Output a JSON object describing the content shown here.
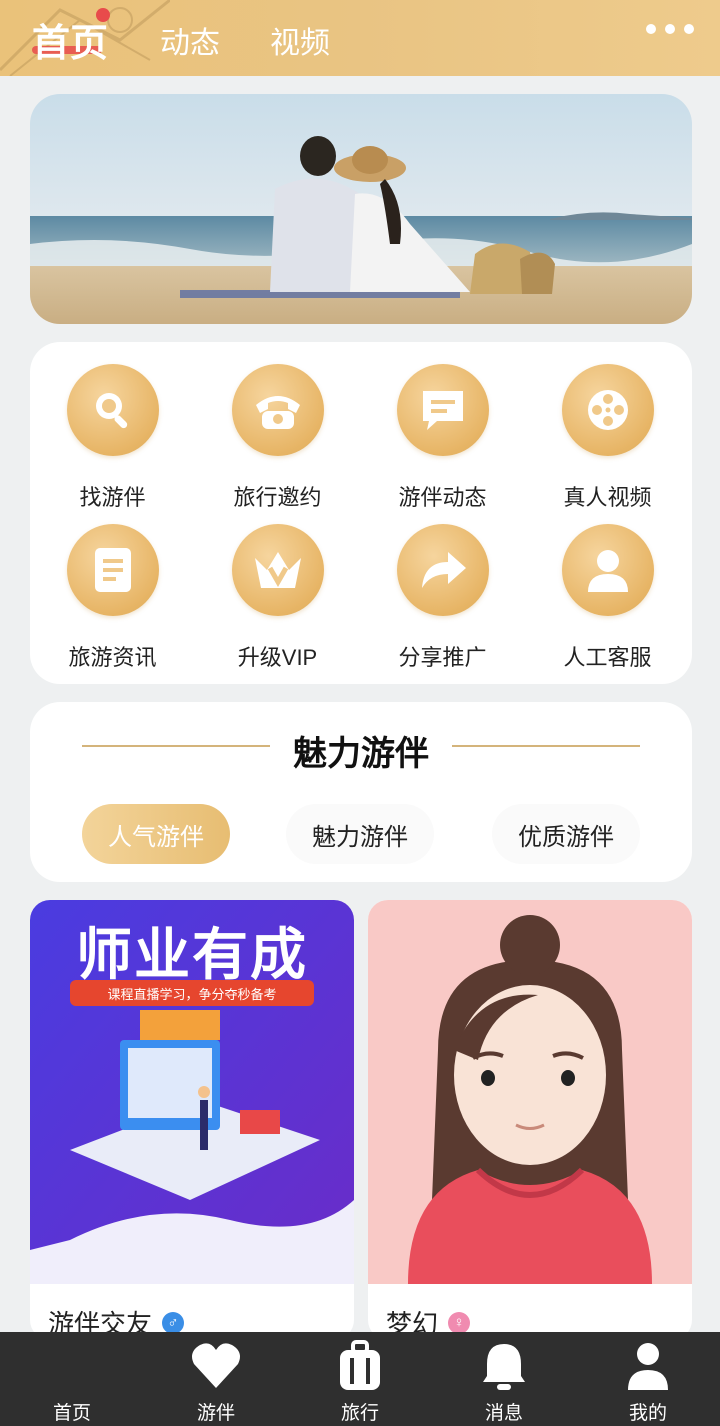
{
  "header": {
    "tabs": [
      {
        "label": "首页",
        "active": true
      },
      {
        "label": "动态",
        "active": false
      },
      {
        "label": "视频",
        "active": false
      }
    ],
    "more_icon": "more-dots-icon"
  },
  "menu": {
    "items": [
      {
        "label": "找游伴",
        "icon": "search-icon"
      },
      {
        "label": "旅行邀约",
        "icon": "phone-icon"
      },
      {
        "label": "游伴动态",
        "icon": "message-icon"
      },
      {
        "label": "真人视频",
        "icon": "film-reel-icon"
      },
      {
        "label": "旅游资讯",
        "icon": "document-icon"
      },
      {
        "label": "升级VIP",
        "icon": "crown-icon"
      },
      {
        "label": "分享推广",
        "icon": "share-arrow-icon"
      },
      {
        "label": "人工客服",
        "icon": "user-icon"
      }
    ]
  },
  "charm": {
    "title": "魅力游伴",
    "filters": [
      {
        "label": "人气游伴",
        "active": true
      },
      {
        "label": "魅力游伴",
        "active": false
      },
      {
        "label": "优质游伴",
        "active": false
      }
    ]
  },
  "profiles": [
    {
      "name": "游伴交友",
      "gender": "male",
      "gender_symbol": "♂",
      "gender_color": "#3a8ee6",
      "poster_title": "师业有成",
      "poster_subtitle": "课程直播学习，争分夺秒备考"
    },
    {
      "name": "梦幻",
      "gender": "female",
      "gender_symbol": "♀",
      "gender_color": "#f08bb0"
    }
  ],
  "bottom_nav": {
    "items": [
      {
        "label": "首页",
        "icon": "home-icon",
        "active": true
      },
      {
        "label": "游伴",
        "icon": "heart-icon",
        "active": false
      },
      {
        "label": "旅行",
        "icon": "luggage-icon",
        "active": false
      },
      {
        "label": "消息",
        "icon": "bell-icon",
        "active": false
      },
      {
        "label": "我的",
        "icon": "profile-icon",
        "active": false
      }
    ]
  },
  "colors": {
    "accent": "#e8c07a",
    "badge": "#e84b4b",
    "nav_bg": "#2f2f2f"
  }
}
